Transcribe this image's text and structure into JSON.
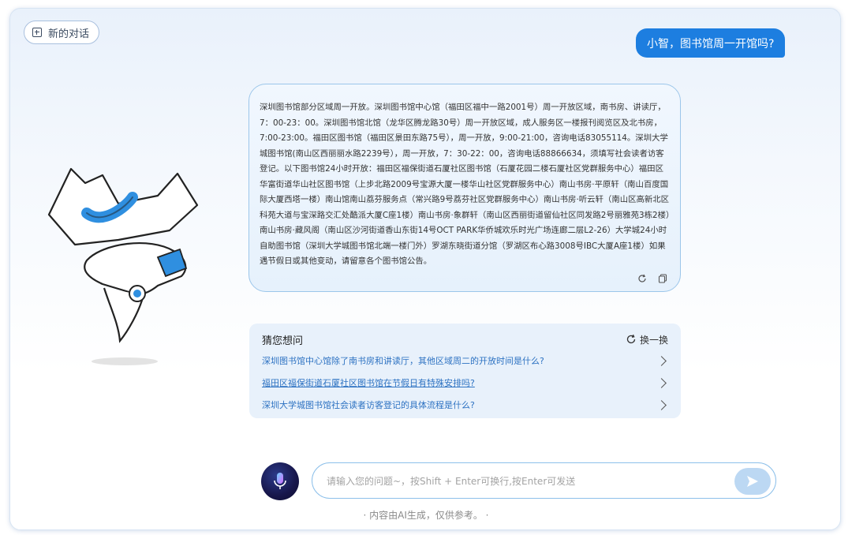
{
  "header": {
    "new_chat_label": "新的对话"
  },
  "user_message": "小智，图书馆周一开馆吗?",
  "answer": {
    "text": "深圳图书馆部分区域周一开放。深圳图书馆中心馆（福田区福中一路2001号）周一开放区域，南书房、讲读厅，7：00-23：00。深圳图书馆北馆（龙华区腾龙路30号）周一开放区域，成人服务区一楼报刊阅览区及北书房，7:00-23:00。福田区图书馆（福田区景田东路75号），周一开放，9:00-21:00，咨询电话83055114。深圳大学城图书馆(南山区西丽丽水路2239号），周一开放，7：30-22：00，咨询电话88866634，须填写社会读者访客登记。以下图书馆24小时开放：福田区福保街道石厦社区图书馆（石厦花园二楼石厦社区党群服务中心）福田区华富街道华山社区图书馆（上步北路2009号宝源大厦一楼华山社区党群服务中心）南山书房·平原轩（南山百度国际大厦西塔一楼）南山馆南山荔芬服务点（常兴路9号荔芬社区党群服务中心）南山书房·听云轩（南山区高新北区科苑大道与宝深路交汇处酷派大厦C座1楼）南山书房·象群轩（南山区西丽街道留仙社区同发路2号丽雅苑3栋2楼）南山书房·藏风阁（南山区沙河街道香山东街14号OCT PARK华侨城欢乐时光广场连廊二层L2-26）大学城24小时自助图书馆（深圳大学城图书馆北端一楼门外）罗湖东晓街道分馆（罗湖区布心路3008号IBC大厦A座1楼）如果遇节假日或其他变动，请留意各个图书馆公告。"
  },
  "suggestions": {
    "title": "猜您想问",
    "refresh_label": "换一换",
    "items": [
      "深圳图书馆中心馆除了南书房和讲读厅，其他区域周二的开放时间是什么?",
      "福田区福保街道石厦社区图书馆在节假日有特殊安排吗?",
      "深圳大学城图书馆社会读者访客登记的具体流程是什么?"
    ]
  },
  "input": {
    "placeholder": "请输入您的问题~，按Shift + Enter可换行,按Enter可发送"
  },
  "disclaimer": "· 内容由AI生成，仅供参考。 ·",
  "colors": {
    "accent": "#1d7ee0",
    "illustration_blue": "#2f8fe0",
    "suggest_link": "#2d72c2"
  },
  "icons": [
    "plus-square-icon",
    "refresh-icon",
    "copy-icon",
    "chevron-right-icon",
    "microphone-icon",
    "send-icon"
  ]
}
